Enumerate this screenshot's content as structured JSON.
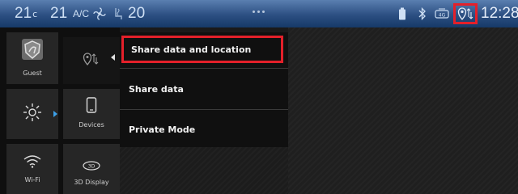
{
  "status_bar": {
    "temp_left": "21",
    "temp_left_unit": "c",
    "temp_right": "21",
    "ac_label": "A/C",
    "fan_speed": "20",
    "clock": "12:28",
    "icons": [
      "fan-icon",
      "seat-heat-icon",
      "battery-icon",
      "bluetooth-icon",
      "4g-icon",
      "location-share-icon"
    ]
  },
  "tiles": {
    "guest_label": "Guest",
    "devices_label": "Devices",
    "wifi_label": "Wi-Fi",
    "display3d_label": "3D Display"
  },
  "share_menu": {
    "items": [
      {
        "label": "Share data and location",
        "selected": true
      },
      {
        "label": "Share data",
        "selected": false
      },
      {
        "label": "Private Mode",
        "selected": false
      }
    ]
  },
  "colors": {
    "highlight": "#e4202a",
    "statusbar_top": "#5a7fb0",
    "statusbar_bottom": "#163a68",
    "accent_arrow": "#3da0e8"
  }
}
